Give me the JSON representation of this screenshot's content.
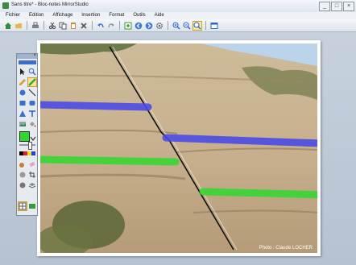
{
  "window": {
    "title": "Sans titre* - Bloc-notes MirrorStudio",
    "min": "_",
    "max": "□",
    "close": "×"
  },
  "menu": [
    "Fichier",
    "Edition",
    "Affichage",
    "Insertion",
    "Format",
    "Outils",
    "Aide"
  ],
  "photo": {
    "credit": "Photo : Claude LOCHER"
  },
  "colors": {
    "blue_line": "#4848e8",
    "green_line": "#2fd82f",
    "fault_line": "#111111",
    "accent": "#2a62c9"
  }
}
